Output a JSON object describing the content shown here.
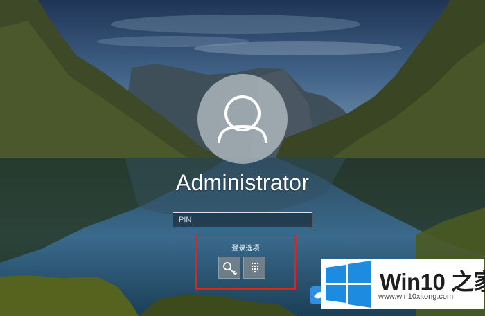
{
  "lock_screen": {
    "user_name": "Administrator",
    "pin_placeholder": "PIN",
    "signin_options_label": "登录选项",
    "signin_options": [
      {
        "name": "security-key",
        "icon": "key-icon"
      },
      {
        "name": "pin",
        "icon": "pin-keypad-icon"
      }
    ]
  },
  "watermark": {
    "title": "Win10 之家",
    "url": "www.win10xitong.com",
    "logo_icon": "windows-logo-icon"
  },
  "colors": {
    "highlight_border": "#e0241b",
    "windows_blue": "#1c8be0"
  }
}
